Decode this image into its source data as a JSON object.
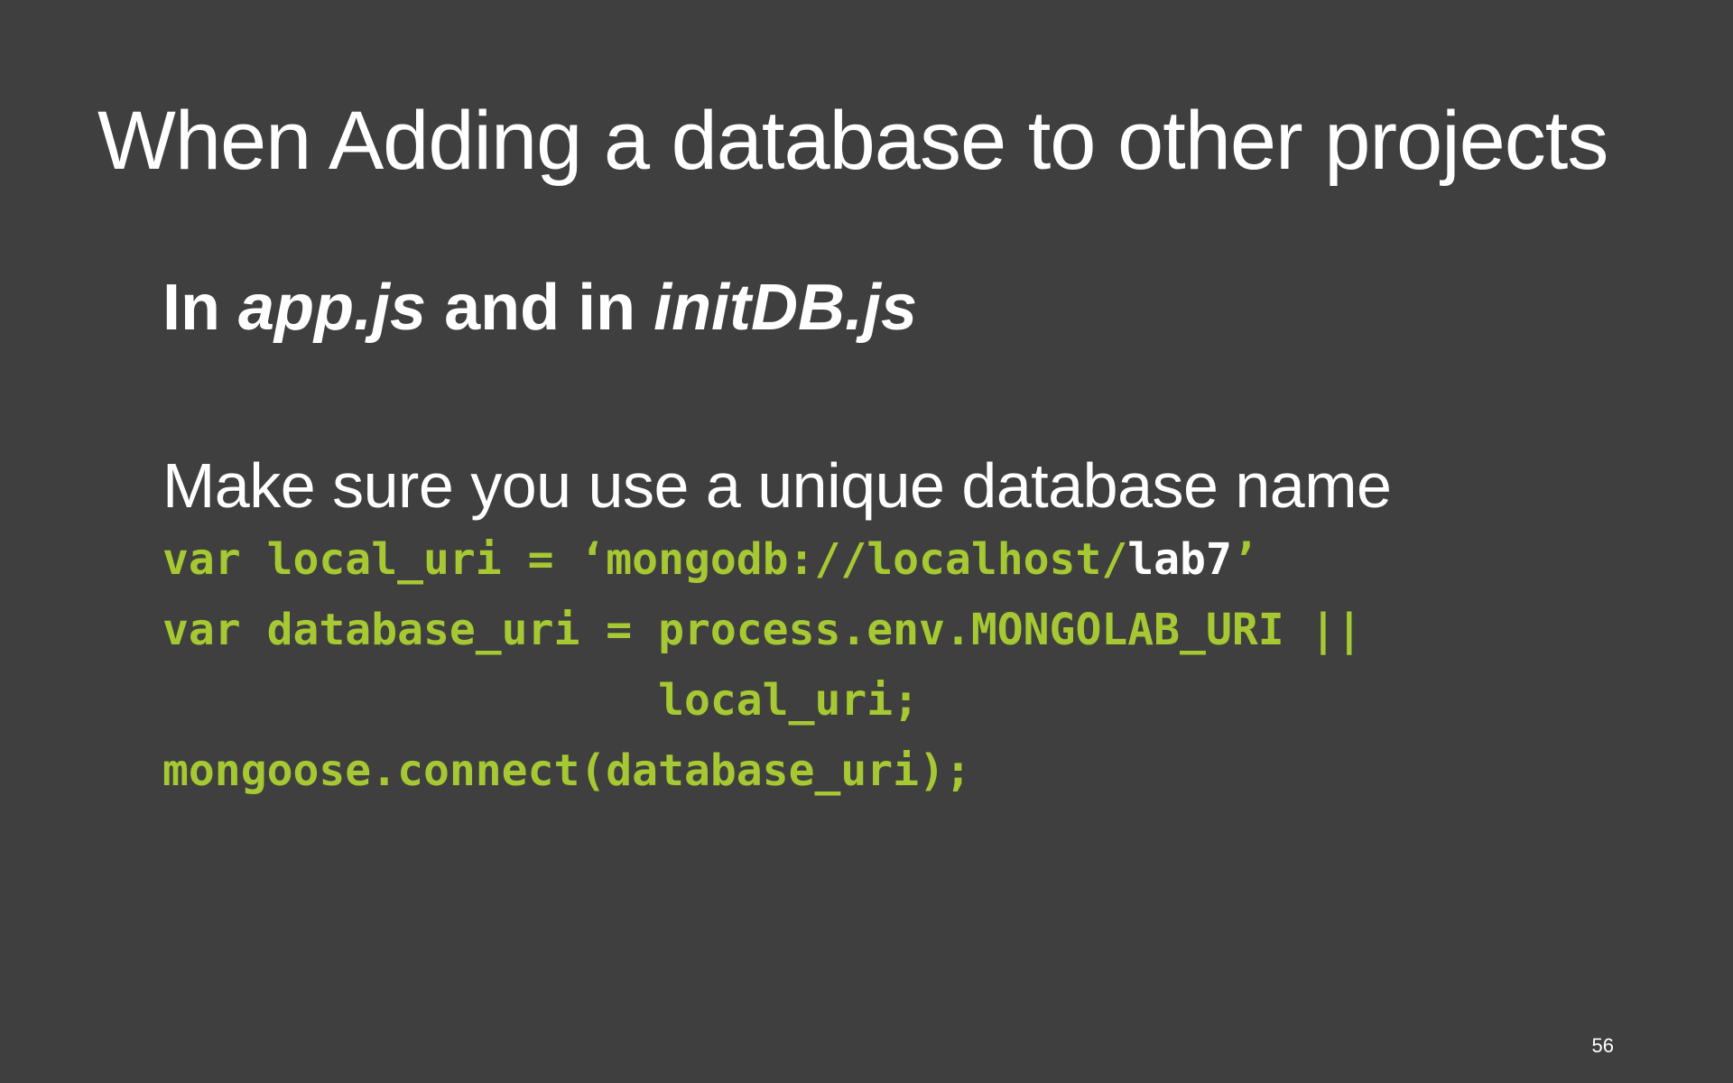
{
  "slide": {
    "title": "When Adding a database to other projects",
    "subtitle": {
      "prefix": "In ",
      "file1": "app.js",
      "middle": " and in ",
      "file2": "initDB.js"
    },
    "body": "Make sure you use a unique database name",
    "code": {
      "line1_pre": "var local_uri = ‘mongodb://localhost/",
      "line1_db": "lab7",
      "line1_post": "’",
      "line2": "var database_uri = process.env.MONGOLAB_URI ||",
      "line3": "                   local_uri;",
      "line4": "mongoose.connect(database_uri);"
    },
    "page_number": "56"
  },
  "colors": {
    "background": "#3f3f3f",
    "text": "#ffffff",
    "code": "#a6c832"
  }
}
